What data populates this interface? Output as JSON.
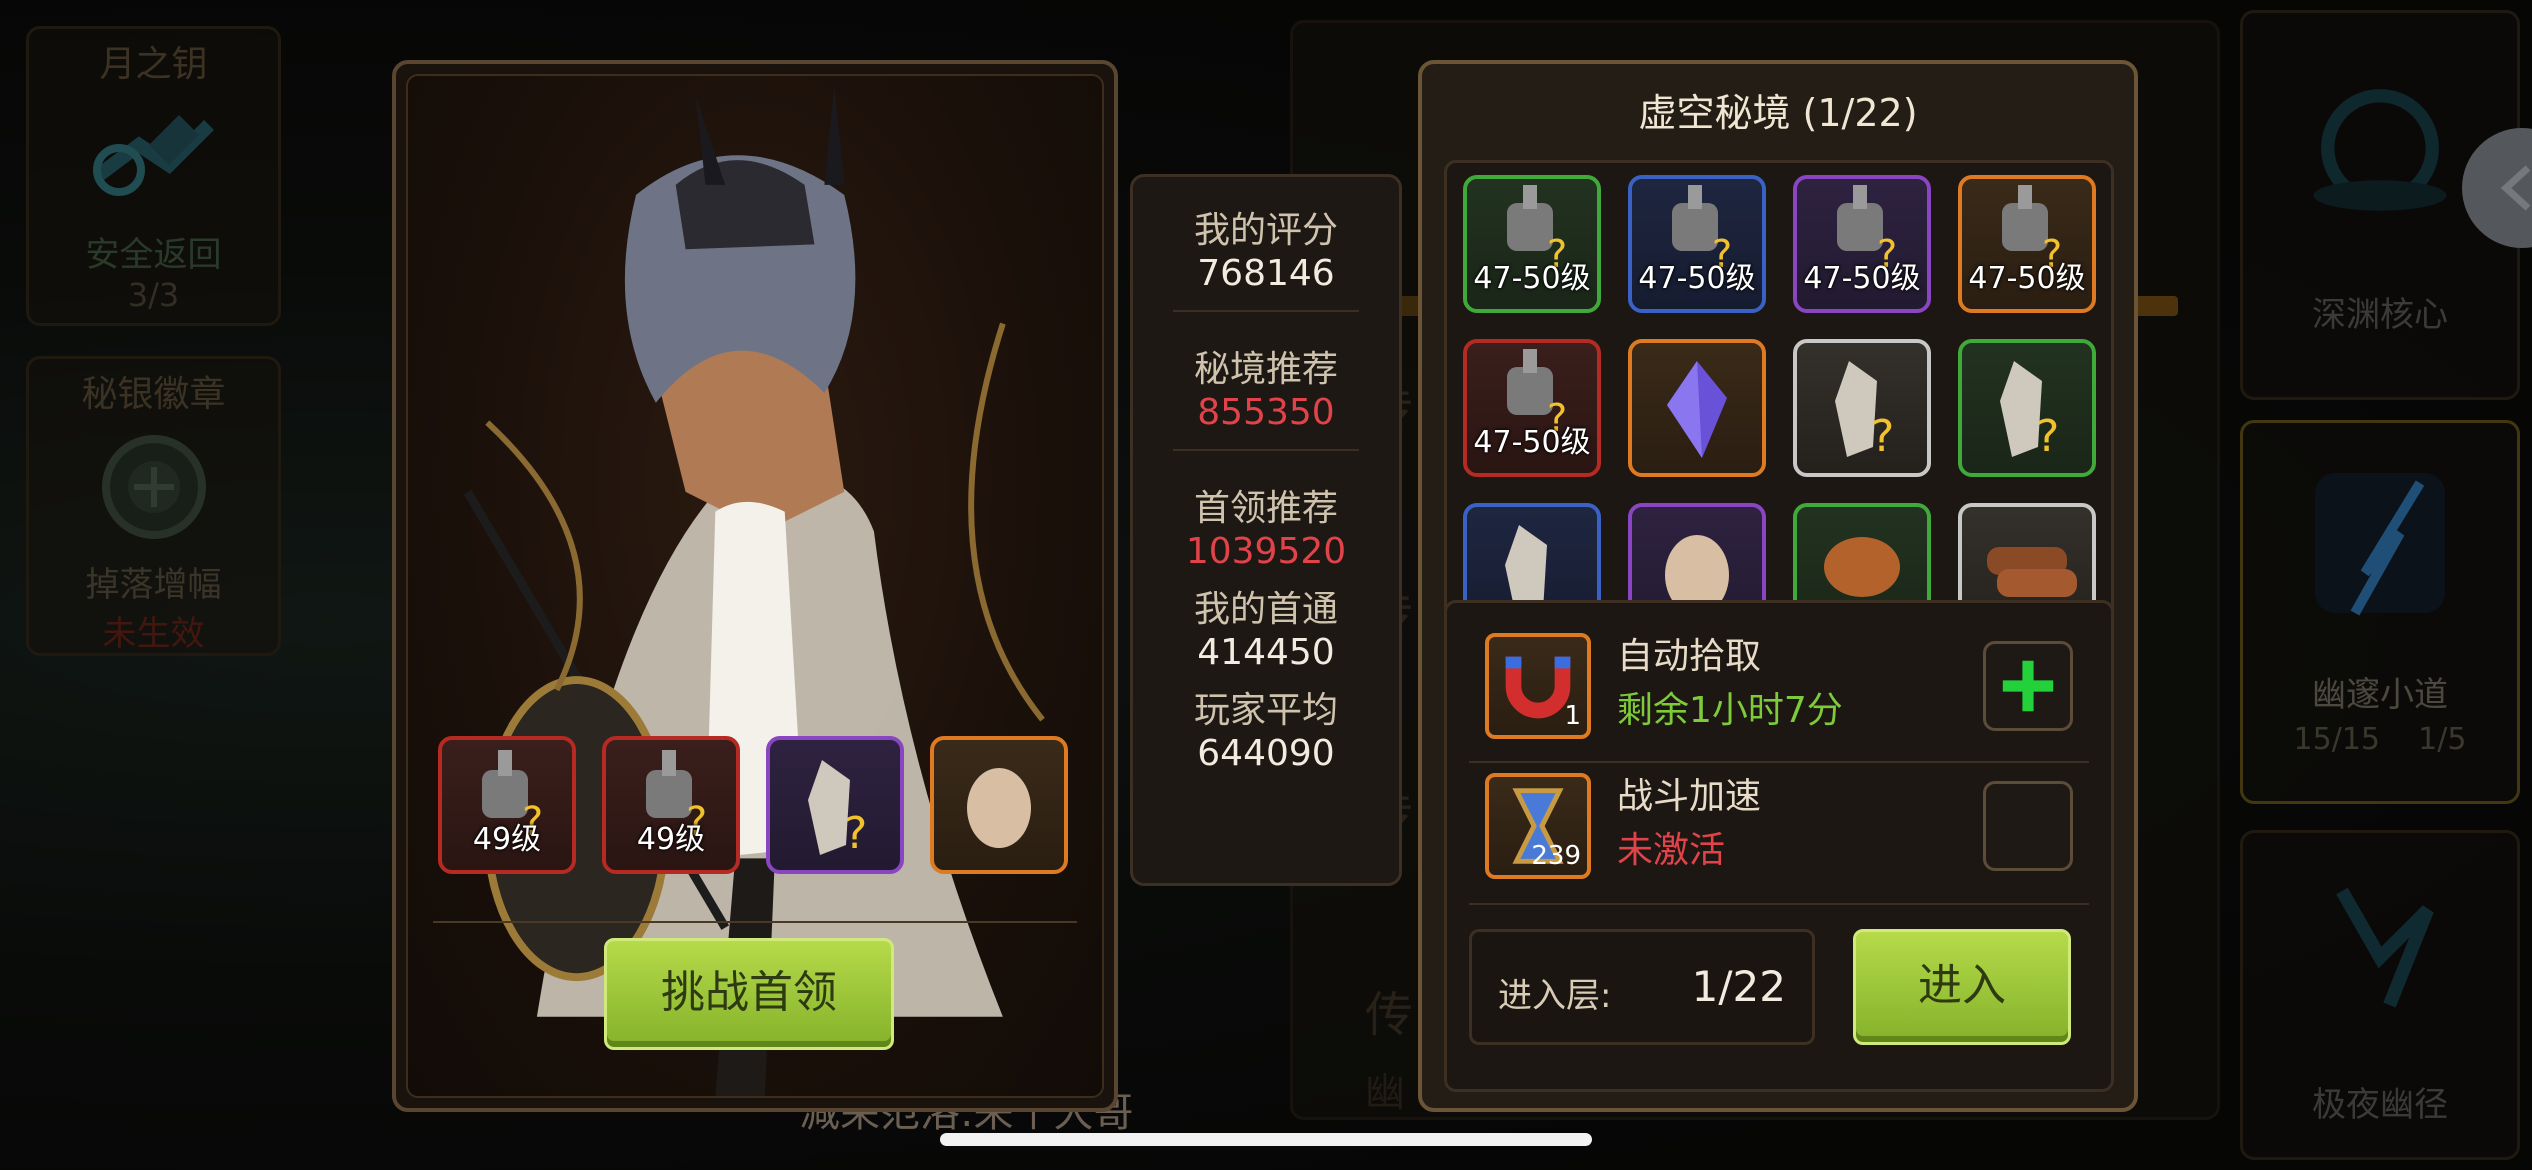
{
  "left_side": {
    "moon_key": {
      "title": "月之钥",
      "label": "安全返回",
      "count": "3/3"
    },
    "mithril_badge": {
      "title": "秘银徽章",
      "label": "掉落增幅",
      "status": "未生效"
    }
  },
  "right_side": {
    "card1": {
      "label": "深渊核心"
    },
    "card2": {
      "label": "幽邃小道",
      "stat1": "15/15",
      "stat2": "1/5"
    },
    "card3": {
      "label": "极夜幽径"
    }
  },
  "behind": {
    "line1": "传",
    "line2": "传",
    "line3": "传",
    "line4": "传",
    "sub": "幽"
  },
  "chat": "减荣范洛:来个大哥",
  "boss_panel": {
    "loot": [
      {
        "icon": "armor-mystery-icon",
        "level": "49级",
        "rarity": "red"
      },
      {
        "icon": "armor-mystery-icon",
        "level": "49级",
        "rarity": "red"
      },
      {
        "icon": "crystal-mystery-icon",
        "level": "",
        "rarity": "purple"
      },
      {
        "icon": "egg-icon",
        "level": "",
        "rarity": "orange"
      }
    ],
    "challenge_button": "挑战首领"
  },
  "stats": {
    "my_score_label": "我的评分",
    "my_score": "768146",
    "realm_rec_label": "秘境推荐",
    "realm_rec": "855350",
    "boss_rec_label": "首领推荐",
    "boss_rec": "1039520",
    "my_first_label": "我的首通",
    "my_first": "414450",
    "player_avg_label": "玩家平均",
    "player_avg": "644090"
  },
  "realm_panel": {
    "title": "虚空秘境 (1/22)",
    "grid": [
      {
        "icon": "armor-mystery-icon",
        "level": "47-50级",
        "rarity": "green"
      },
      {
        "icon": "armor-mystery-icon",
        "level": "47-50级",
        "rarity": "blue"
      },
      {
        "icon": "armor-mystery-icon",
        "level": "47-50级",
        "rarity": "purple"
      },
      {
        "icon": "armor-mystery-icon",
        "level": "47-50级",
        "rarity": "orange"
      },
      {
        "icon": "armor-mystery-icon",
        "level": "47-50级",
        "rarity": "red"
      },
      {
        "icon": "purple-gem-icon",
        "level": "",
        "rarity": "orange"
      },
      {
        "icon": "crystal-mystery-icon",
        "level": "",
        "rarity": "white"
      },
      {
        "icon": "crystal-mystery-icon",
        "level": "",
        "rarity": "green"
      },
      {
        "icon": "crystal-mystery-icon",
        "level": "",
        "rarity": "blue"
      },
      {
        "icon": "egg-icon",
        "level": "",
        "rarity": "purple"
      },
      {
        "icon": "meat-icon",
        "level": "",
        "rarity": "green"
      },
      {
        "icon": "wood-icon",
        "level": "",
        "rarity": "white"
      }
    ],
    "auto_pickup": {
      "name": "自动拾取",
      "remaining": "剩余1小时7分",
      "count": "1"
    },
    "battle_speed": {
      "name": "战斗加速",
      "status": "未激活",
      "count": "239"
    },
    "floor_label": "进入层:",
    "floor_value": "1/22",
    "enter_button": "进入"
  },
  "colors": {
    "accent_green": "#9ccc3a",
    "red_text": "#e0434a",
    "green_text": "#7ecb3a"
  }
}
